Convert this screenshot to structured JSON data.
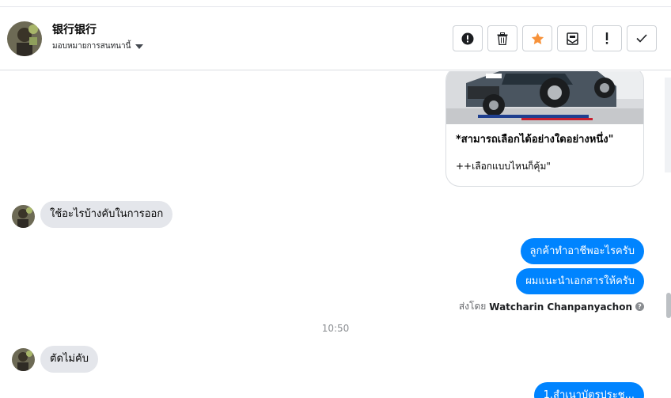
{
  "header": {
    "contact_name": "银行银行",
    "assign_label": "มอบหมายการสนทนานี้"
  },
  "actions": [
    {
      "icon": "alert-circle-icon",
      "label": "mark as spam"
    },
    {
      "icon": "trash-icon",
      "label": "delete"
    },
    {
      "icon": "star-icon",
      "label": "star"
    },
    {
      "icon": "mark-unread-icon",
      "label": "mark unread"
    },
    {
      "icon": "exclamation-icon",
      "label": "follow up"
    },
    {
      "icon": "check-icon",
      "label": "done"
    }
  ],
  "card": {
    "title": "*สามารถเลือกได้อย่างใดอย่างหนึ่ง\"",
    "description": "++เลือกแบบไหนก็คุ้ม\""
  },
  "messages": {
    "in_1": "ใช้อะไรบ้างคับในการออก",
    "out_1": "ลูกค้าทำอาชีพอะไรครับ",
    "out_2": "ผมแนะนำเอกสารให้ครับ",
    "sent_by_prefix": "ส่งโดย",
    "sent_by_name": "Watcharin Chanpanyachon",
    "timestamp": "10:50",
    "in_2": "ตัดไม่คับ",
    "out_3": "1.สำเนาบัตรประช..."
  },
  "colors": {
    "outgoing_bubble": "#0084ff",
    "incoming_bubble": "#e4e6eb",
    "star": "#f7923a"
  }
}
